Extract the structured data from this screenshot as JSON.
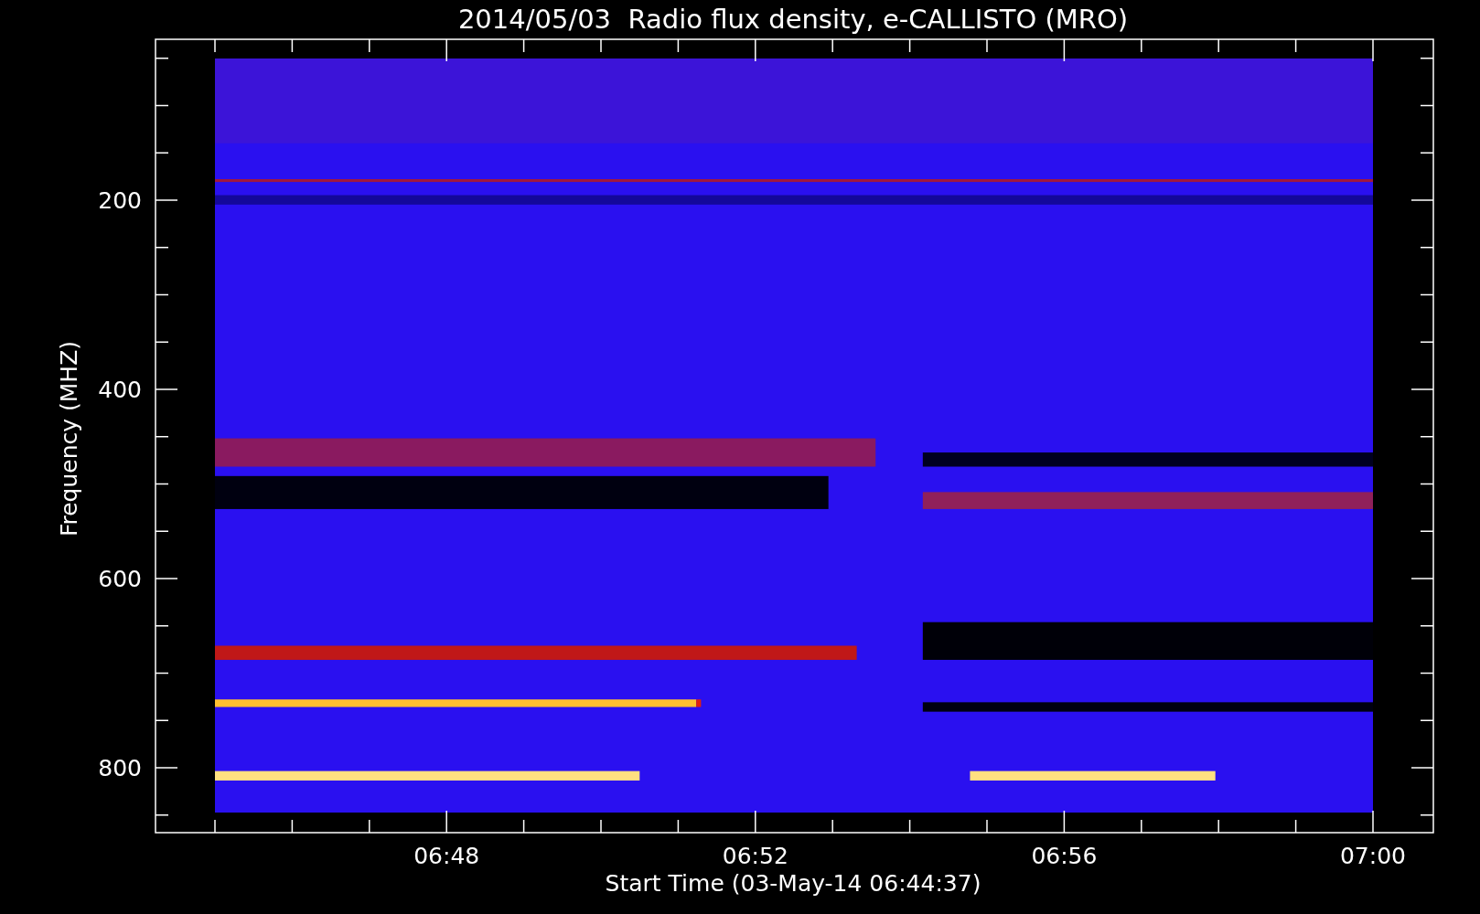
{
  "title": "2014/05/03  Radio flux density, e-CALLISTO (MRO)",
  "y_axis": {
    "label": "Frequency (MHZ)",
    "ticks": [
      "200",
      "400",
      "600",
      "800"
    ]
  },
  "x_axis": {
    "label": "Start Time (03-May-14 06:44:37)",
    "ticks": [
      "06:48",
      "06:52",
      "06:56",
      "07:00"
    ]
  }
}
